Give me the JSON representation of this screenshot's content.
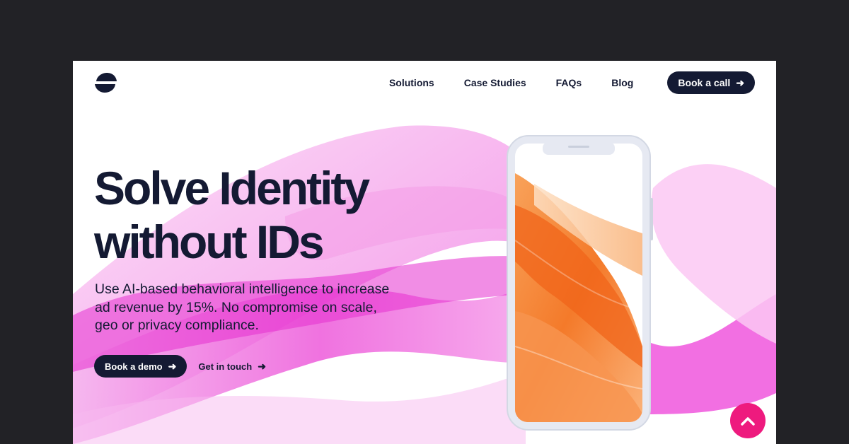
{
  "nav": {
    "items": [
      "Solutions",
      "Case Studies",
      "FAQs",
      "Blog"
    ],
    "cta_label": "Book a call"
  },
  "hero": {
    "title_lines": [
      "Solve Identity",
      "without IDs"
    ],
    "subtitle_lines": [
      "Use AI-based behavioral intelligence to increase",
      "ad revenue by 15%. No compromise on scale,",
      "geo or privacy compliance."
    ],
    "primary_cta": "Book a demo",
    "secondary_cta": "Get in touch"
  },
  "icons": {
    "arrow": "arrow-right-icon",
    "scroll_top": "chevron-up-icon",
    "logo": "brand-logo"
  },
  "colors": {
    "ink": "#141a33",
    "accent_magenta": "#ee1a7e",
    "wave_pink": "#f04bd6",
    "screen_orange": "#f47a2a"
  }
}
